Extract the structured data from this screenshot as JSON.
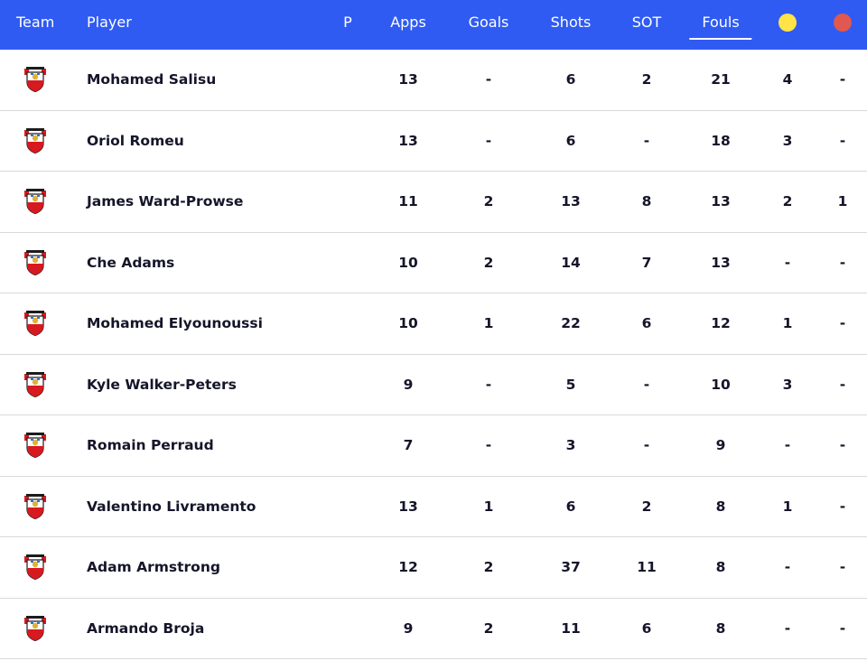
{
  "columns": {
    "team": "Team",
    "player": "Player",
    "p": "P",
    "apps": "Apps",
    "goals": "Goals",
    "shots": "Shots",
    "sot": "SOT",
    "fouls": "Fouls"
  },
  "card_icons": {
    "yellow": {
      "icon": "yellow-card-icon",
      "color": "#ffe347"
    },
    "red": {
      "icon": "red-card-icon",
      "color": "#e0584f"
    }
  },
  "colors": {
    "header_bg": "#2f5bf3",
    "row_divider": "#d9d9de",
    "crest_red": "#d71920"
  },
  "sorted_by": "Fouls",
  "rows": [
    {
      "team_icon": "southampton-crest-icon",
      "player": "Mohamed Salisu",
      "apps": "13",
      "goals": "-",
      "shots": "6",
      "sot": "2",
      "fouls": "21",
      "yellow": "4",
      "red": "-"
    },
    {
      "team_icon": "southampton-crest-icon",
      "player": "Oriol Romeu",
      "apps": "13",
      "goals": "-",
      "shots": "6",
      "sot": "-",
      "fouls": "18",
      "yellow": "3",
      "red": "-"
    },
    {
      "team_icon": "southampton-crest-icon",
      "player": "James Ward-Prowse",
      "apps": "11",
      "goals": "2",
      "shots": "13",
      "sot": "8",
      "fouls": "13",
      "yellow": "2",
      "red": "1"
    },
    {
      "team_icon": "southampton-crest-icon",
      "player": "Che Adams",
      "apps": "10",
      "goals": "2",
      "shots": "14",
      "sot": "7",
      "fouls": "13",
      "yellow": "-",
      "red": "-"
    },
    {
      "team_icon": "southampton-crest-icon",
      "player": "Mohamed Elyounoussi",
      "apps": "10",
      "goals": "1",
      "shots": "22",
      "sot": "6",
      "fouls": "12",
      "yellow": "1",
      "red": "-"
    },
    {
      "team_icon": "southampton-crest-icon",
      "player": "Kyle Walker-Peters",
      "apps": "9",
      "goals": "-",
      "shots": "5",
      "sot": "-",
      "fouls": "10",
      "yellow": "3",
      "red": "-"
    },
    {
      "team_icon": "southampton-crest-icon",
      "player": "Romain Perraud",
      "apps": "7",
      "goals": "-",
      "shots": "3",
      "sot": "-",
      "fouls": "9",
      "yellow": "-",
      "red": "-"
    },
    {
      "team_icon": "southampton-crest-icon",
      "player": "Valentino Livramento",
      "apps": "13",
      "goals": "1",
      "shots": "6",
      "sot": "2",
      "fouls": "8",
      "yellow": "1",
      "red": "-"
    },
    {
      "team_icon": "southampton-crest-icon",
      "player": "Adam Armstrong",
      "apps": "12",
      "goals": "2",
      "shots": "37",
      "sot": "11",
      "fouls": "8",
      "yellow": "-",
      "red": "-"
    },
    {
      "team_icon": "southampton-crest-icon",
      "player": "Armando Broja",
      "apps": "9",
      "goals": "2",
      "shots": "11",
      "sot": "6",
      "fouls": "8",
      "yellow": "-",
      "red": "-"
    }
  ]
}
